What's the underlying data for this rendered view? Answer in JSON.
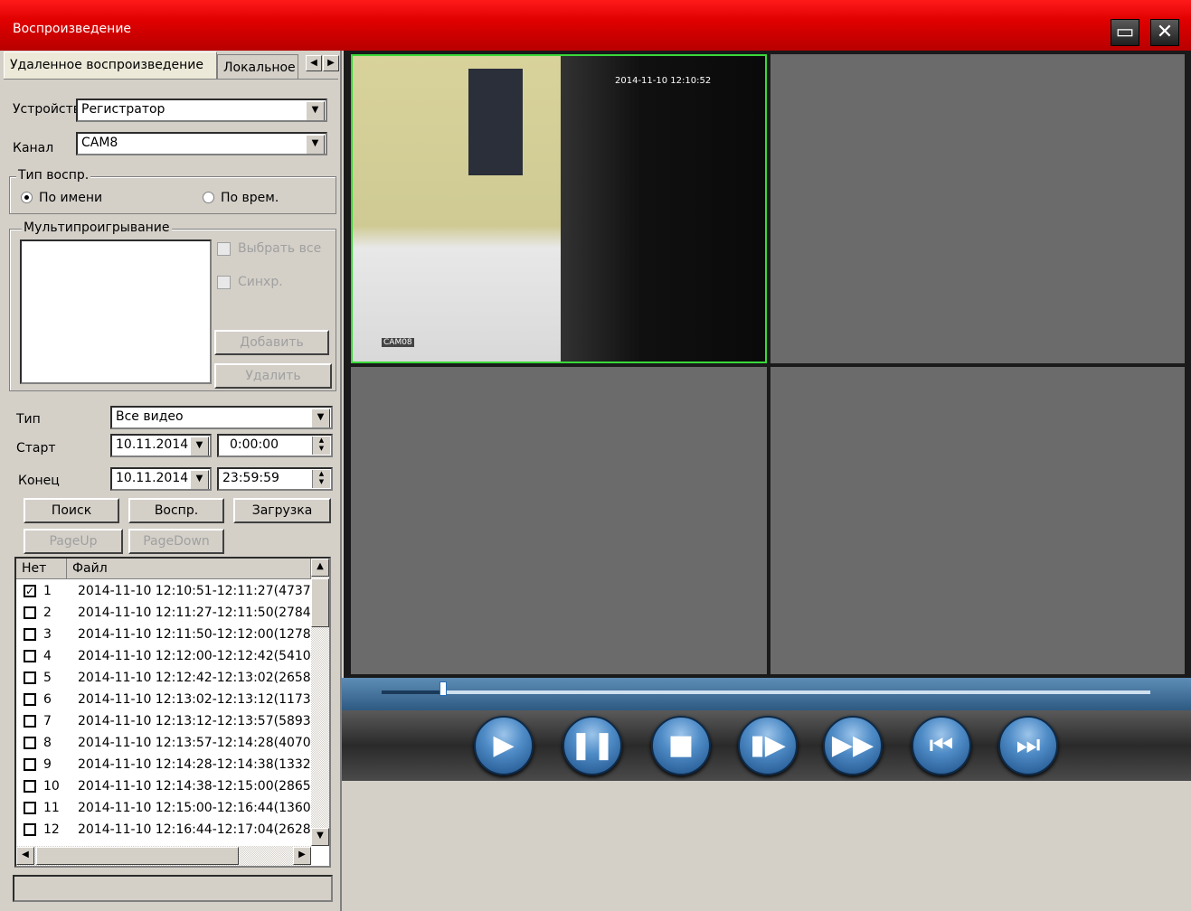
{
  "window": {
    "title": "Воспроизведение",
    "restore_icon": "restore-icon",
    "close_icon": "close-icon"
  },
  "tabs": {
    "remote": "Удаленное воспроизведение",
    "local": "Локальное"
  },
  "device": {
    "label": "Устройств",
    "value": "Регистратор"
  },
  "channel": {
    "label": "Канал",
    "value": "CAM8"
  },
  "play_type": {
    "group_label": "Тип воспр.",
    "by_name": "По имени",
    "by_time": "По врем."
  },
  "multi": {
    "group_label": "Мультипроигрывание",
    "select_all": "Выбрать все",
    "sync": "Синхр.",
    "add": "Добавить",
    "delete": "Удалить"
  },
  "filter": {
    "type_label": "Тип",
    "type_value": "Все видео",
    "start_label": "Старт",
    "start_date": "10.11.2014",
    "start_time": "0:00:00",
    "end_label": "Конец",
    "end_date": "10.11.2014",
    "end_time": "23:59:59"
  },
  "actions": {
    "search": "Поиск",
    "play": "Воспр.",
    "download": "Загрузка",
    "page_up": "PageUp",
    "page_down": "PageDown"
  },
  "file_table": {
    "col_no": "Нет",
    "col_file": "Файл",
    "rows": [
      {
        "checked": true,
        "no": "1",
        "file": "2014-11-10 12:10:51-12:11:27(4737"
      },
      {
        "checked": false,
        "no": "2",
        "file": "2014-11-10 12:11:27-12:11:50(2784"
      },
      {
        "checked": false,
        "no": "3",
        "file": "2014-11-10 12:11:50-12:12:00(1278"
      },
      {
        "checked": false,
        "no": "4",
        "file": "2014-11-10 12:12:00-12:12:42(5410"
      },
      {
        "checked": false,
        "no": "5",
        "file": "2014-11-10 12:12:42-12:13:02(2658"
      },
      {
        "checked": false,
        "no": "6",
        "file": "2014-11-10 12:13:02-12:13:12(1173"
      },
      {
        "checked": false,
        "no": "7",
        "file": "2014-11-10 12:13:12-12:13:57(5893"
      },
      {
        "checked": false,
        "no": "8",
        "file": "2014-11-10 12:13:57-12:14:28(4070"
      },
      {
        "checked": false,
        "no": "9",
        "file": "2014-11-10 12:14:28-12:14:38(1332"
      },
      {
        "checked": false,
        "no": "10",
        "file": "2014-11-10 12:14:38-12:15:00(2865"
      },
      {
        "checked": false,
        "no": "11",
        "file": "2014-11-10 12:15:00-12:16:44(1360"
      },
      {
        "checked": false,
        "no": "12",
        "file": "2014-11-10 12:16:44-12:17:04(2628"
      }
    ]
  },
  "video": {
    "timestamp": "2014-11-10 12:10:52",
    "camera_label": "CAM08",
    "progress_fraction": 0.08
  },
  "controls": [
    "play-icon",
    "pause-icon",
    "stop-icon",
    "step-frame-icon",
    "fast-forward-icon",
    "previous-icon",
    "next-icon"
  ]
}
